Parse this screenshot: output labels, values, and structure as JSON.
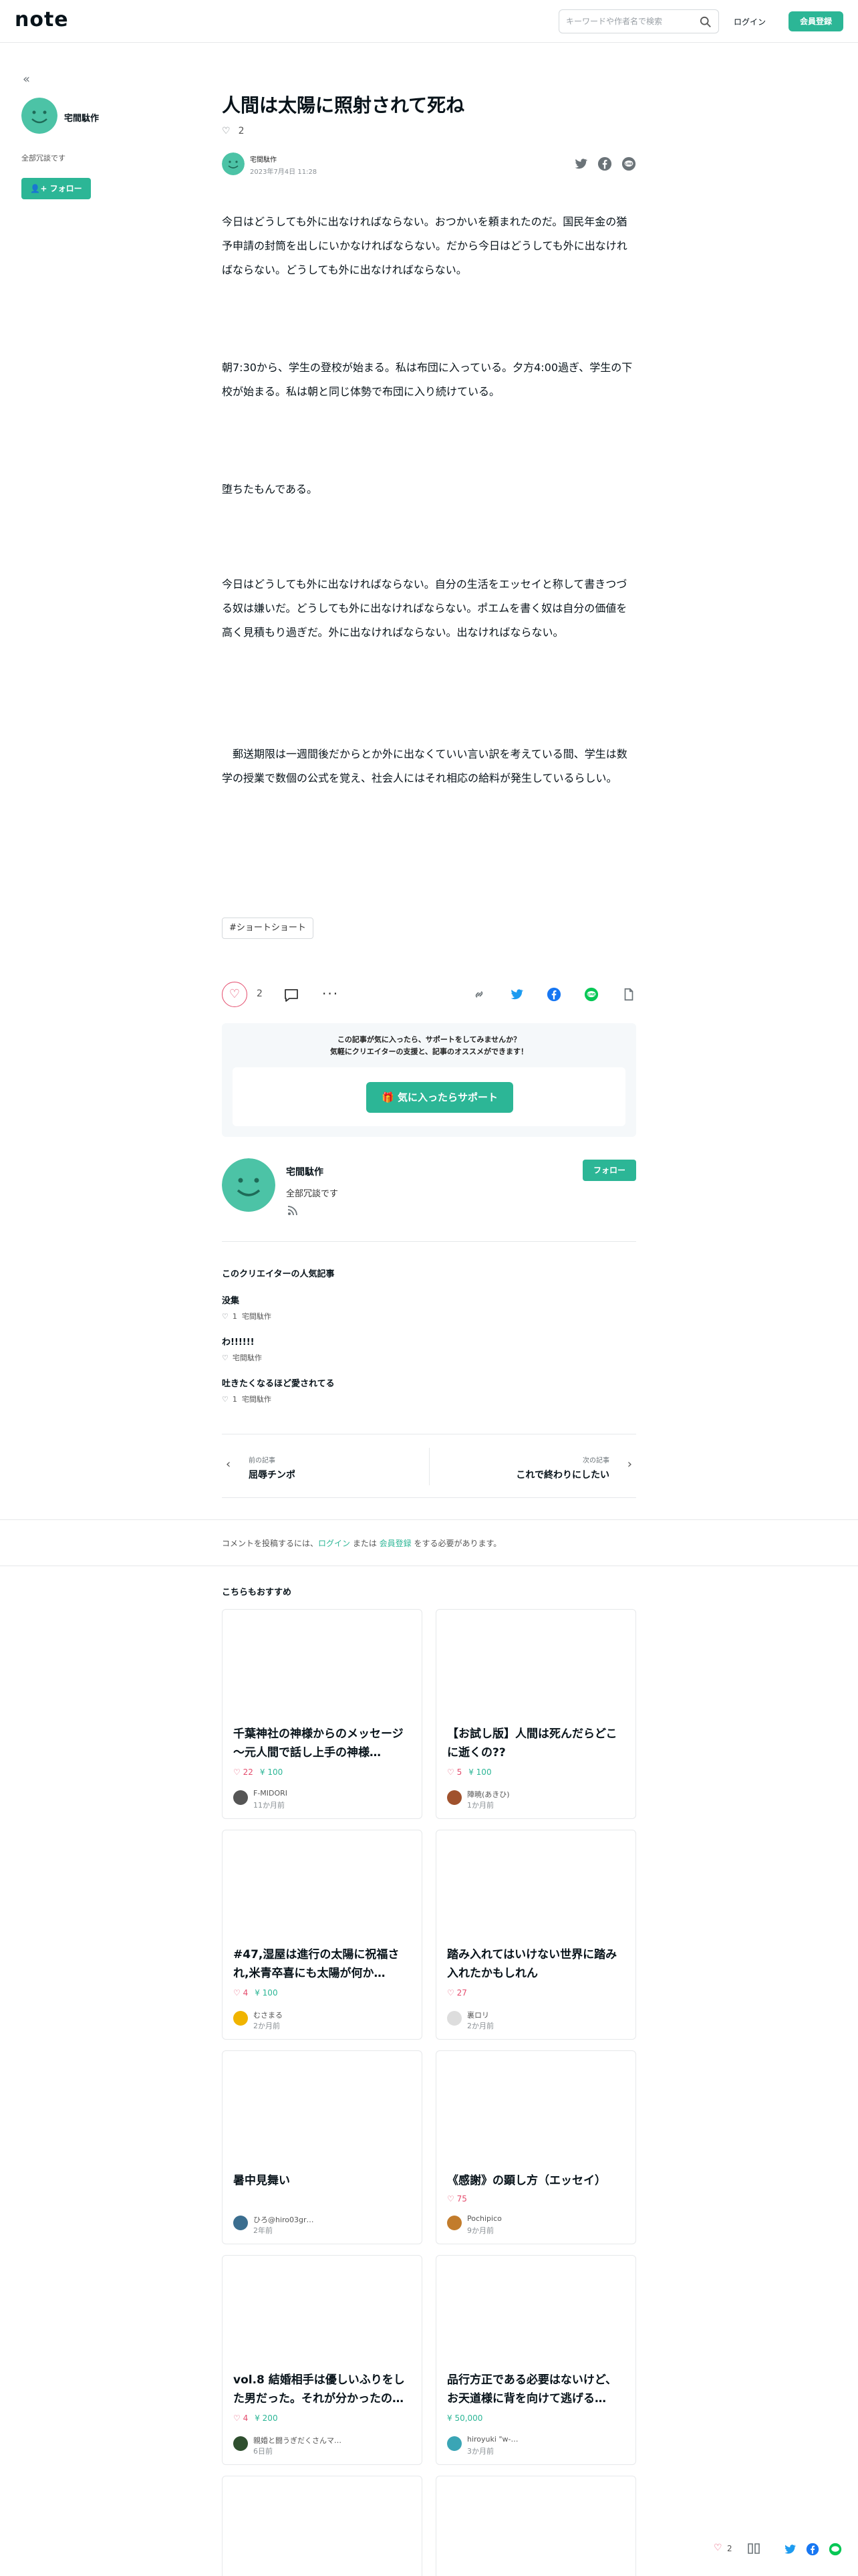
{
  "header": {
    "logo": "note",
    "search_placeholder": "キーワードや作者名で検索",
    "login": "ログイン",
    "signup": "会員登録"
  },
  "sidebar": {
    "name": "宅間駄作",
    "bio": "全部冗談です",
    "follow": "フォロー"
  },
  "article": {
    "title": "人間は太陽に照射されて死ね",
    "likes": "2",
    "author": "宅間駄作",
    "date": "2023年7月4日 11:28",
    "paragraphs": [
      "今日はどうしても外に出なければならない。おつかいを頼まれたのだ。国民年金の猶予申請の封筒を出しにいかなければならない。だから今日はどうしても外に出なければならない。どうしても外に出なければならない。",
      "朝7:30から、学生の登校が始まる。私は布団に入っている。夕方4:00過ぎ、学生の下校が始まる。私は朝と同じ体勢で布団に入り続けている。",
      "堕ちたもんである。",
      "今日はどうしても外に出なければならない。自分の生活をエッセイと称して書きつづる奴は嫌いだ。どうしても外に出なければならない。ポエムを書く奴は自分の価値を高く見積もり過ぎだ。外に出なければならない。出なければならない。",
      "　郵送期限は一週間後だからとか外に出なくていい言い訳を考えている間、学生は数学の授業で数個の公式を覚え、社会人にはそれ相応の給料が発生しているらしい。"
    ],
    "hashtag": "#ショートショート",
    "like_count": "2"
  },
  "support": {
    "line1": "この記事が気に入ったら、サポートをしてみませんか？",
    "line2": "気軽にクリエイターの支援と、記事のオススメができます！",
    "button": "気に入ったらサポート"
  },
  "profile_card": {
    "name": "宅間駄作",
    "bio": "全部冗談です",
    "follow": "フォロー"
  },
  "popular": {
    "title": "このクリエイターの人気記事",
    "items": [
      {
        "title": "没集",
        "likes": "1",
        "author": "宅間駄作"
      },
      {
        "title": "わ!!!!!!",
        "likes": "",
        "author": "宅間駄作"
      },
      {
        "title": "吐きたくなるほど愛されてる",
        "likes": "1",
        "author": "宅間駄作"
      }
    ]
  },
  "prev_next": {
    "prev_label": "前の記事",
    "prev_title": "屈辱チンポ",
    "next_label": "次の記事",
    "next_title": "これで終わりにしたい"
  },
  "comment": {
    "before": "コメントを投稿するには、",
    "login": "ログイン",
    "middle": " または ",
    "signup": "会員登録",
    "after": " をする必要があります。"
  },
  "recommend": {
    "title": "こちらもおすすめ",
    "cards": [
      {
        "title": "千葉神社の神様からのメッセージ 〜元人間で話し上手の神様…",
        "likes": "22",
        "tip": "100",
        "author": "F-MIDORI",
        "time": "11か月前",
        "avatar_color": "#555555"
      },
      {
        "title": "【お試し版】人間は死んだらどこに逝くの??",
        "likes": "5",
        "tip": "100",
        "author": "陣暁(あきひ)",
        "time": "1か月前",
        "avatar_color": "#a0522d"
      },
      {
        "title": "#47,湿屋は進行の太陽に祝福され,米青卒喜にも太陽が何か…",
        "likes": "4",
        "tip": "100",
        "author": "むさまる",
        "time": "2か月前",
        "avatar_color": "#f0b400"
      },
      {
        "title": "踏み入れてはいけない世界に踏み入れたかもしれん",
        "likes": "27",
        "tip": "",
        "author": "裏ロリ",
        "time": "2か月前",
        "avatar_color": "#dddddd"
      },
      {
        "title": "暑中見舞い",
        "likes": "",
        "tip": "",
        "author": "ひろ@hiro03gr…",
        "time": "2年前",
        "avatar_color": "#3b6e8f"
      },
      {
        "title": "《感謝》の顕し方（エッセイ）",
        "likes": "75",
        "tip": "",
        "author": "Pochipico",
        "time": "9か月前",
        "avatar_color": "#c27c2c"
      },
      {
        "title": "vol.8 結婚相手は優しいふりをした男だった。それが分かったの…",
        "likes": "4",
        "tip": "200",
        "author": "親婚と闘うぎだくさんマ…",
        "time": "6日前",
        "avatar_color": "#2f4f2f"
      },
      {
        "title": "品行方正である必要はないけど、お天道様に背を向けて逃げる…",
        "likes": "",
        "tip": "50,000",
        "author": "hiroyuki \"w-…",
        "time": "3か月前",
        "avatar_color": "#3aa5b5"
      }
    ]
  },
  "bottom_bar": {
    "likes": "2"
  },
  "colors": {
    "accent": "#2cb696",
    "like": "#e44c6d"
  }
}
